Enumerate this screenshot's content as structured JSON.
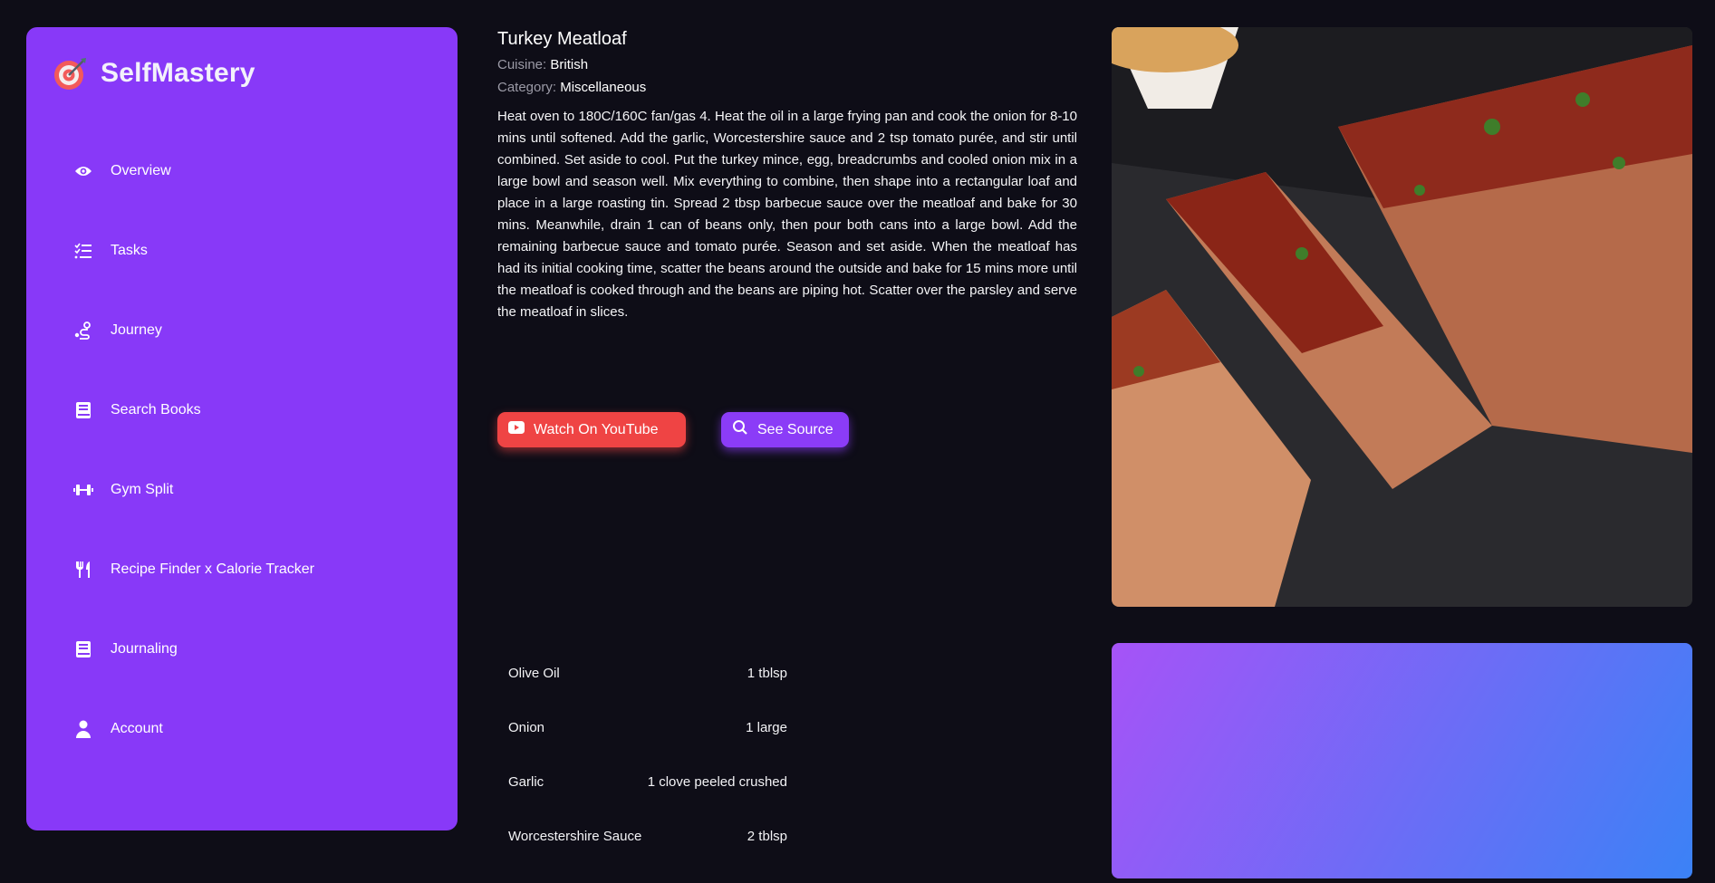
{
  "app": {
    "name": "SelfMastery",
    "logo_icon": "target-icon"
  },
  "sidebar": {
    "items": [
      {
        "label": "Overview",
        "icon": "eye-icon"
      },
      {
        "label": "Tasks",
        "icon": "checklist-icon"
      },
      {
        "label": "Journey",
        "icon": "route-icon"
      },
      {
        "label": "Search Books",
        "icon": "book-icon"
      },
      {
        "label": "Gym Split",
        "icon": "dumbbell-icon"
      },
      {
        "label": "Recipe Finder x Calorie Tracker",
        "icon": "utensils-icon"
      },
      {
        "label": "Journaling",
        "icon": "book-icon"
      },
      {
        "label": "Account",
        "icon": "user-icon"
      }
    ]
  },
  "recipe": {
    "title": "Turkey Meatloaf",
    "cuisine_label": "Cuisine:",
    "cuisine": "British",
    "category_label": "Category:",
    "category": "Miscellaneous",
    "instructions": "Heat oven to 180C/160C fan/gas 4. Heat the oil in a large frying pan and cook the onion for 8-10 mins until softened. Add the garlic, Worcestershire sauce and 2 tsp tomato purée, and stir until combined. Set aside to cool. Put the turkey mince, egg, breadcrumbs and cooled onion mix in a large bowl and season well. Mix everything to combine, then shape into a rectangular loaf and place in a large roasting tin. Spread 2 tbsp barbecue sauce over the meatloaf and bake for 30 mins. Meanwhile, drain 1 can of beans only, then pour both cans into a large bowl. Add the remaining barbecue sauce and tomato purée. Season and set aside. When the meatloaf has had its initial cooking time, scatter the beans around the outside and bake for 15 mins more until the meatloaf is cooked through and the beans are piping hot. Scatter over the parsley and serve the meatloaf in slices.",
    "youtube_label": "Watch On YouTube",
    "source_label": "See Source",
    "ingredients": [
      {
        "name": "Olive Oil",
        "measure": "1 tblsp"
      },
      {
        "name": "Onion",
        "measure": "1 large"
      },
      {
        "name": "Garlic",
        "measure": "1 clove peeled crushed"
      },
      {
        "name": "Worcestershire Sauce",
        "measure": "2 tblsp"
      }
    ]
  },
  "colors": {
    "sidebar": "#8839f8",
    "youtube": "#ef4444",
    "source": "#8b3cf7",
    "background": "#0e0d17"
  }
}
